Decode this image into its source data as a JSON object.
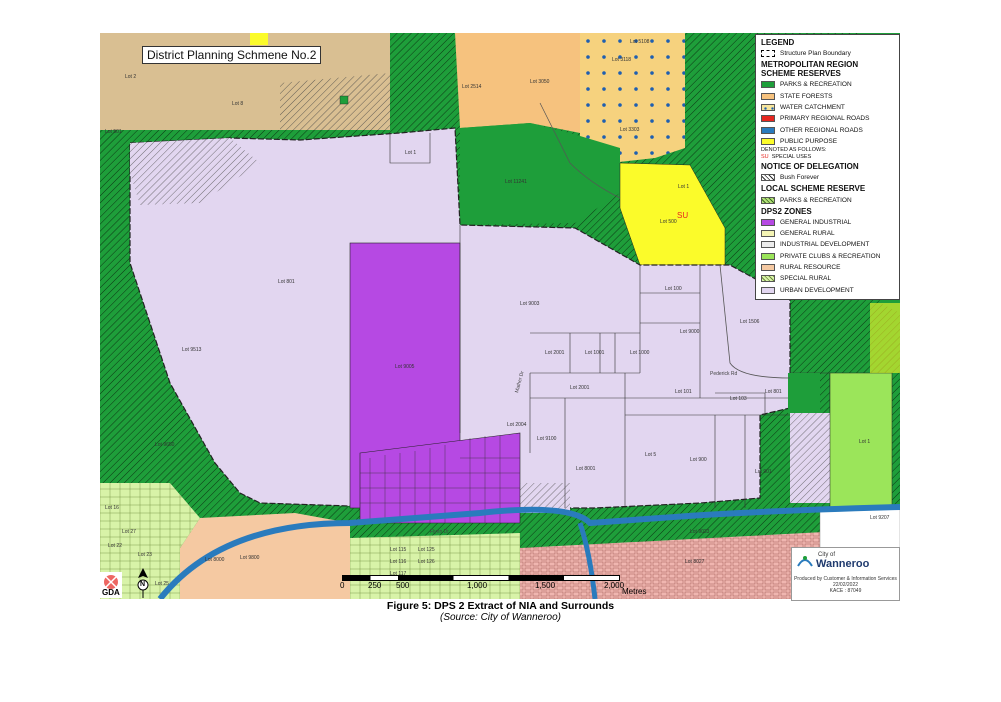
{
  "plan_title": "District Planning Schmene No.2",
  "legend": {
    "title": "LEGEND",
    "boundary": "Structure Plan Boundary",
    "mrs_heading": "METROPOLITAN REGION SCHEME RESERVES",
    "mrs_items": [
      {
        "label": "PARKS & RECREATION",
        "color": "#1e9e3a"
      },
      {
        "label": "STATE FORESTS",
        "color": "#f6c27e"
      },
      {
        "label": "WATER CATCHMENT",
        "color": "#f6e59c"
      },
      {
        "label": "PRIMARY REGIONAL ROADS",
        "color": "#e6261f"
      },
      {
        "label": "OTHER REGIONAL ROADS",
        "color": "#2a7bbd"
      },
      {
        "label": "PUBLIC PURPOSE",
        "color": "#fbfb2a"
      }
    ],
    "denoted": "DENOTED AS FOLLOWS:",
    "su_code": "SU",
    "su_label": "SPECIAL USES",
    "delegation_heading": "NOTICE OF DELEGATION",
    "bush_forever": "Bush Forever",
    "local_heading": "LOCAL SCHEME RESERVE",
    "local_item": "PARKS & RECREATION",
    "dps2_heading": "DPS2 ZONES",
    "dps2_items": [
      {
        "label": "GENERAL INDUSTRIAL",
        "color": "#b649e3"
      },
      {
        "label": "GENERAL RURAL",
        "color": "#f4f4b4"
      },
      {
        "label": "INDUSTRIAL DEVELOPMENT",
        "color": "#ececec"
      },
      {
        "label": "PRIVATE CLUBS & RECREATION",
        "color": "#9be55a"
      },
      {
        "label": "RURAL RESOURCE",
        "color": "#f5c9a2"
      },
      {
        "label": "SPECIAL RURAL",
        "color": "#d8f3a8"
      },
      {
        "label": "URBAN DEVELOPMENT",
        "color": "#e2d6f0"
      }
    ]
  },
  "lots": [
    "Lot 2",
    "Lot 8",
    "Lot 1",
    "Lot 501",
    "Lot 2514",
    "Lot 3050",
    "Lot 3118",
    "Lot 5108",
    "Lot 3303",
    "Lot 11241",
    "Lot 1",
    "Lot 500",
    "Lot 801",
    "Lot 9005",
    "Lot 9003",
    "Lot 100",
    "Lot 9000",
    "Lot 1506",
    "Lot 2001",
    "Lot 1001",
    "Lot 1000",
    "Lot 2001",
    "Lot 101",
    "Lot 103",
    "Lot 801",
    "Lot 2004",
    "Lot 9100",
    "Lot 8001",
    "Lot 5",
    "Lot 900",
    "Lot 901",
    "Lot 1",
    "Lot 9800",
    "Lot 115",
    "Lot 116",
    "Lot 117",
    "Lot 125",
    "Lot 126",
    "Lot 8000",
    "Lot 9207",
    "Lot 8027",
    "Lot 9033",
    "Lot 16",
    "Lot 22",
    "Lot 23",
    "Lot 27",
    "Lot 25",
    "Lot 9513",
    "Lot 9650"
  ],
  "su_label_on_map": "SU",
  "roads": [
    "Pederick Rd",
    "Flynn Dr",
    "Mather Dr"
  ],
  "scale": {
    "ticks": [
      "0",
      "250",
      "500",
      "1,000",
      "1,500",
      "2,000"
    ],
    "unit": "Metres"
  },
  "logo": {
    "city_small": "City of",
    "city": "Wanneroo",
    "line1": "Produced by Customer & Information Services",
    "line2": "22/02/2022",
    "line3": "KACE : 87049"
  },
  "gda": "GDA",
  "north": "N",
  "caption": {
    "title": "Figure 5: DPS 2 Extract of NIA and Surrounds",
    "source": "(Source: City of Wanneroo)"
  }
}
